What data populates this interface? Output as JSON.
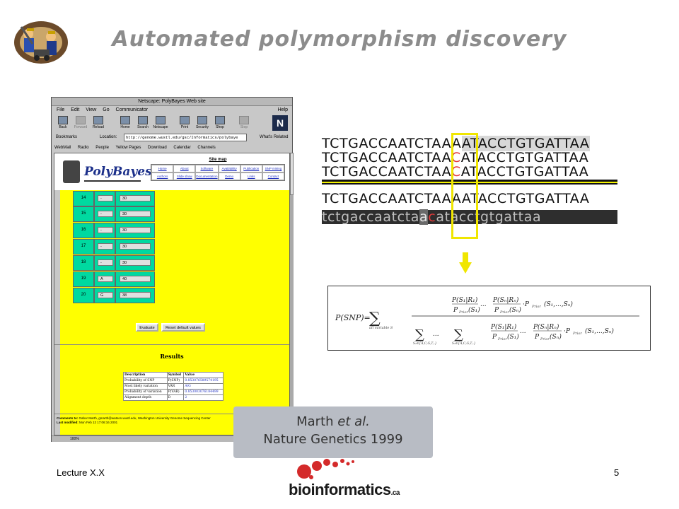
{
  "slide": {
    "title": "Automated polymorphism discovery",
    "footer_left": "Lecture X.X",
    "page_number": "5",
    "logo_text": "bioinformatics",
    "logo_suffix": ".ca",
    "citation_author": "Marth ",
    "citation_etal": "et al.",
    "citation_journal": "Nature Genetics 1999"
  },
  "browser": {
    "window_title": "Netscape: PolyBayes Web site",
    "menu": [
      "File",
      "Edit",
      "View",
      "Go",
      "Communicator"
    ],
    "menu_help": "Help",
    "toolbar": [
      {
        "label": "Back",
        "icon": "back-arrow-icon",
        "enabled": true
      },
      {
        "label": "Forward",
        "icon": "forward-arrow-icon",
        "enabled": false
      },
      {
        "label": "Reload",
        "icon": "reload-icon",
        "enabled": true
      },
      {
        "label": "Home",
        "icon": "home-icon",
        "enabled": true
      },
      {
        "label": "Search",
        "icon": "search-icon",
        "enabled": true
      },
      {
        "label": "Netscape",
        "icon": "netscape-icon",
        "enabled": true
      },
      {
        "label": "Print",
        "icon": "print-icon",
        "enabled": true
      },
      {
        "label": "Security",
        "icon": "lock-icon",
        "enabled": true
      },
      {
        "label": "Shop",
        "icon": "shop-icon",
        "enabled": true
      },
      {
        "label": "Stop",
        "icon": "stop-icon",
        "enabled": false
      }
    ],
    "bookmarks_label": "Bookmarks",
    "location_label": "Location:",
    "location_url": "http://genome.wustl.edu/gsc/Informatics/polybaye",
    "whats_related": "What's Related",
    "personal_toolbar": [
      "WebMail",
      "Radio",
      "People",
      "Yellow Pages",
      "Download",
      "Calendar",
      "Channels"
    ],
    "status_zoom": "100%"
  },
  "polybayes": {
    "logo": "PolyBayes",
    "site_map_title": "Site map",
    "site_map_links": [
      "Home",
      "About",
      "Software",
      "Availability",
      "Publication",
      "SNP mining",
      "Authors",
      "Slide show",
      "Documentation",
      "Demo",
      "Links",
      "Contact"
    ],
    "rows": [
      {
        "id": "14",
        "base": "-",
        "quality": "30"
      },
      {
        "id": "15",
        "base": "-",
        "quality": "30"
      },
      {
        "id": "16",
        "base": "-",
        "quality": "30"
      },
      {
        "id": "17",
        "base": "-",
        "quality": "30"
      },
      {
        "id": "18",
        "base": "-",
        "quality": "30"
      },
      {
        "id": "19",
        "base": "A",
        "quality": "40"
      },
      {
        "id": "20",
        "base": "G",
        "quality": "38"
      }
    ],
    "evaluate_button": "Evaluate",
    "reset_button": "Reset default values",
    "results_title": "Results",
    "results_headers": [
      "Description",
      "Symbol",
      "Value"
    ],
    "results_rows": [
      [
        "Probability of SNP",
        "P(SNP)",
        "0.853076589574195"
      ],
      [
        "Most likely variation",
        "VAR",
        "A/G"
      ],
      [
        "Probability of variation",
        "P(VAR)",
        "0.853003076184499"
      ],
      [
        "Alignment depth",
        "D",
        "2"
      ]
    ],
    "comments_label": "Comments to:",
    "comments_text": "Gabor Marth, gmarth@watson.wustl.edu, Washington University Genome Sequencing Center",
    "last_modified_label": "Last modified:",
    "last_modified": "Mon Feb 12 17:06:16 2001"
  },
  "alignment": {
    "rows": [
      {
        "pre": "TCTGACCAATCTA",
        "mid": "A",
        "var": "A",
        "post": "ATACCTGTGATTAA",
        "case": "upper"
      },
      {
        "pre": "TCTGACCAATCTA",
        "mid": "A",
        "var": "C",
        "post": "ATACCTGTGATTAA",
        "case": "upper"
      },
      {
        "pre": "TCTGACCAATCTA",
        "mid": "A",
        "var": "C",
        "post": "ATACCTGTGATTAA",
        "case": "upper"
      },
      {
        "pre": "TCTGACCAATCTA",
        "mid": "A",
        "var": "A",
        "post": "ATACCTGTGATTAA",
        "case": "upper"
      },
      {
        "pre": "tctgaccaatcta",
        "mid": "a",
        "var": "c",
        "post": "atacctgtgattaa",
        "case": "lower"
      }
    ]
  },
  "formula": {
    "lhs": "P(SNP)=",
    "sum_outer": "∑",
    "sum_outer_sub": "all variable S",
    "dots": "...",
    "sub_first": "S₁∈{A,C,G,T,-}",
    "sub_last": "Sₙ∈{A,C,G,T,-}",
    "num_term1": "P(S₁|R₁)",
    "den_term1": "P",
    "den_term1_sub": "Prior",
    "den_term1_arg": "(S₁)",
    "num_termN": "P(Sₙ|Rₙ)",
    "den_termN_arg": "(Sₙ)",
    "prior_tail": "·P",
    "prior_tail_arg": "(S₁,...,Sₙ)"
  },
  "colors": {
    "title_gray": "#8c8c8c",
    "highlight_yellow": "#f0e600",
    "variant_red": "#e23a3a",
    "page_yellow": "#ffff00",
    "cell_green": "#00d9a0",
    "logo_red": "#d42a2a"
  }
}
